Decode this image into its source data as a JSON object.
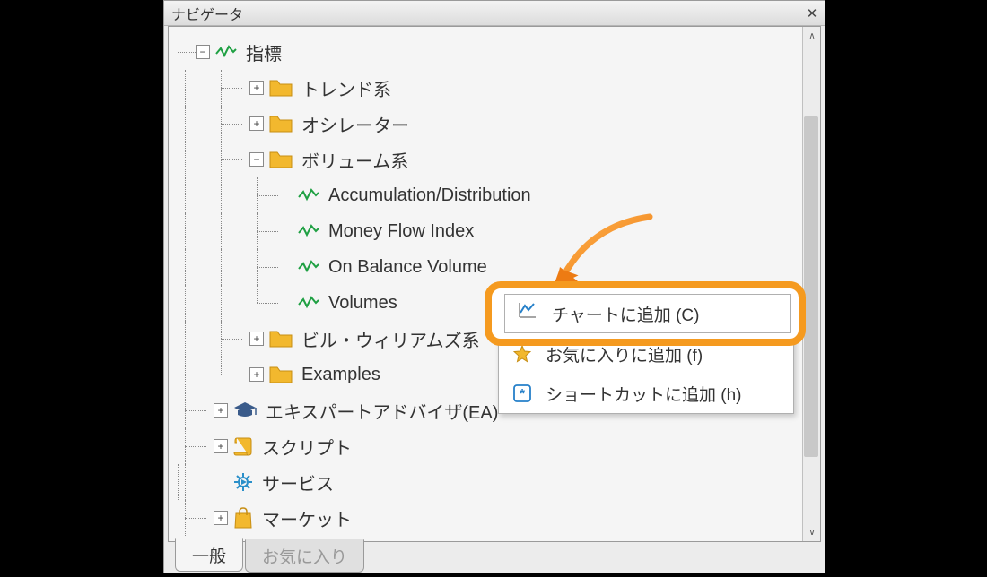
{
  "panel": {
    "title": "ナビゲータ"
  },
  "tree": {
    "indicators": {
      "label": "指標",
      "trend": "トレンド系",
      "oscillator": "オシレーター",
      "volume": {
        "label": "ボリューム系",
        "items": [
          "Accumulation/Distribution",
          "Money Flow Index",
          "On Balance Volume",
          "Volumes"
        ]
      },
      "bill_williams": "ビル・ウィリアムズ系",
      "examples": "Examples"
    },
    "ea": "エキスパートアドバイザ(EA)",
    "scripts": "スクリプト",
    "services": "サービス",
    "market": "マーケット"
  },
  "context_menu": {
    "add_to_chart": "チャートに追加 (C)",
    "add_to_favorites": "お気に入りに追加 (f)",
    "add_shortcut": "ショートカットに追加 (h)"
  },
  "tabs": {
    "general": "一般",
    "favorites": "お気に入り"
  }
}
